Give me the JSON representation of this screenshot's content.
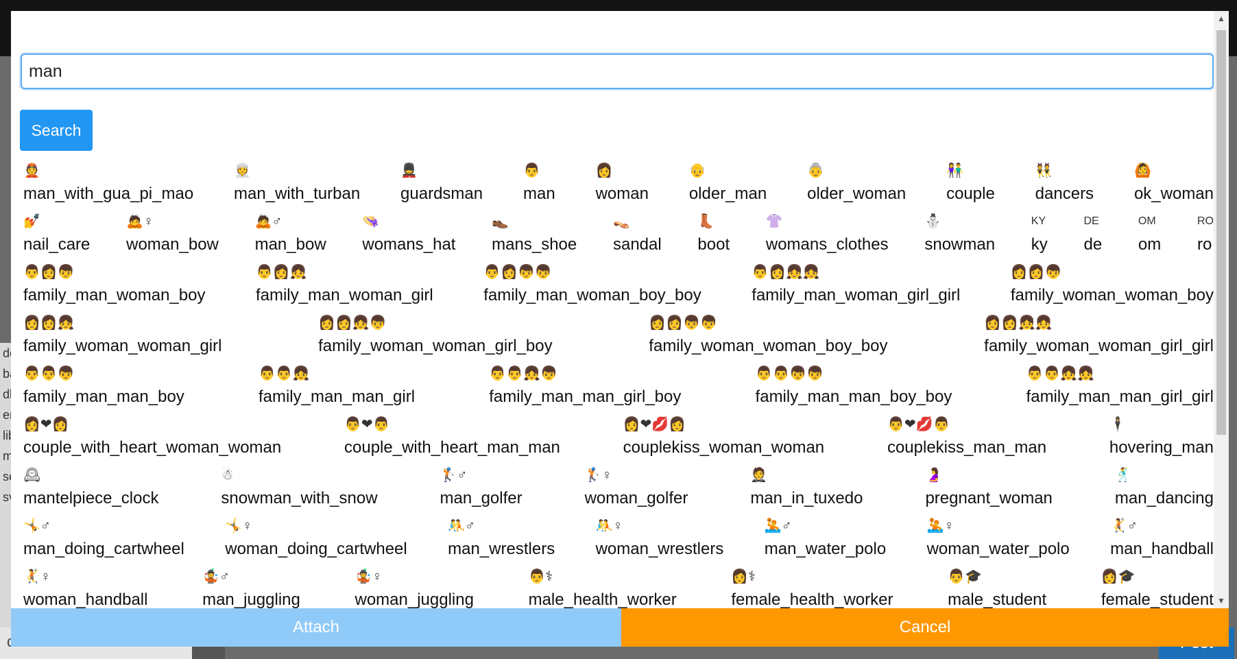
{
  "background": {
    "side_lines": [
      "de",
      "ba",
      "dl",
      "er",
      "lib",
      "m",
      "se",
      "sv"
    ],
    "bottom_field_text": "devnewton",
    "post_label": "Post"
  },
  "search": {
    "value": "man",
    "button_label": "Search"
  },
  "results": [
    [
      {
        "emoji": "👲",
        "name": "man_with_gua_pi_mao"
      },
      {
        "emoji": "👳",
        "name": "man_with_turban"
      },
      {
        "emoji": "💂",
        "name": "guardsman"
      },
      {
        "emoji": "👨",
        "name": "man"
      },
      {
        "emoji": "👩",
        "name": "woman"
      },
      {
        "emoji": "👴",
        "name": "older_man"
      },
      {
        "emoji": "👵",
        "name": "older_woman"
      },
      {
        "emoji": "👫",
        "name": "couple"
      },
      {
        "emoji": "👯",
        "name": "dancers"
      },
      {
        "emoji": "🙆",
        "name": "ok_woman"
      }
    ],
    [
      {
        "emoji": "💅",
        "name": "nail_care"
      },
      {
        "emoji": "🙇♀",
        "name": "woman_bow"
      },
      {
        "emoji": "🙇♂",
        "name": "man_bow"
      },
      {
        "emoji": "👒",
        "name": "womans_hat"
      },
      {
        "emoji": "👞",
        "name": "mans_shoe"
      },
      {
        "emoji": "👡",
        "name": "sandal"
      },
      {
        "emoji": "👢",
        "name": "boot"
      },
      {
        "emoji": "👚",
        "name": "womans_clothes"
      },
      {
        "emoji": "⛄",
        "name": "snowman"
      },
      {
        "emoji": "KY",
        "name": "ky"
      },
      {
        "emoji": "DE",
        "name": "de"
      },
      {
        "emoji": "OM",
        "name": "om"
      },
      {
        "emoji": "RO",
        "name": "ro"
      }
    ],
    [
      {
        "emoji": "👨👩👦",
        "name": "family_man_woman_boy"
      },
      {
        "emoji": "👨👩👧",
        "name": "family_man_woman_girl"
      },
      {
        "emoji": "👨👩👦👦",
        "name": "family_man_woman_boy_boy"
      },
      {
        "emoji": "👨👩👧👧",
        "name": "family_man_woman_girl_girl"
      },
      {
        "emoji": "👩👩👦",
        "name": "family_woman_woman_boy"
      }
    ],
    [
      {
        "emoji": "👩👩👧",
        "name": "family_woman_woman_girl"
      },
      {
        "emoji": "👩👩👧👦",
        "name": "family_woman_woman_girl_boy"
      },
      {
        "emoji": "👩👩👦👦",
        "name": "family_woman_woman_boy_boy"
      },
      {
        "emoji": "👩👩👧👧",
        "name": "family_woman_woman_girl_girl"
      }
    ],
    [
      {
        "emoji": "👨👨👦",
        "name": "family_man_man_boy"
      },
      {
        "emoji": "👨👨👧",
        "name": "family_man_man_girl"
      },
      {
        "emoji": "👨👨👧👦",
        "name": "family_man_man_girl_boy"
      },
      {
        "emoji": "👨👨👦👦",
        "name": "family_man_man_boy_boy"
      },
      {
        "emoji": "👨👨👧👧",
        "name": "family_man_man_girl_girl"
      }
    ],
    [
      {
        "emoji": "👩❤👩",
        "name": "couple_with_heart_woman_woman"
      },
      {
        "emoji": "👨❤👨",
        "name": "couple_with_heart_man_man"
      },
      {
        "emoji": "👩❤💋👩",
        "name": "couplekiss_woman_woman"
      },
      {
        "emoji": "👨❤💋👨",
        "name": "couplekiss_man_man"
      },
      {
        "emoji": "🕴",
        "name": "hovering_man"
      }
    ],
    [
      {
        "emoji": "🕰",
        "name": "mantelpiece_clock"
      },
      {
        "emoji": "☃",
        "name": "snowman_with_snow"
      },
      {
        "emoji": "🏌♂",
        "name": "man_golfer"
      },
      {
        "emoji": "🏌♀",
        "name": "woman_golfer"
      },
      {
        "emoji": "🤵",
        "name": "man_in_tuxedo"
      },
      {
        "emoji": "🤰",
        "name": "pregnant_woman"
      },
      {
        "emoji": "🕺",
        "name": "man_dancing"
      }
    ],
    [
      {
        "emoji": "🤸♂",
        "name": "man_doing_cartwheel"
      },
      {
        "emoji": "🤸♀",
        "name": "woman_doing_cartwheel"
      },
      {
        "emoji": "🤼♂",
        "name": "man_wrestlers"
      },
      {
        "emoji": "🤼♀",
        "name": "woman_wrestlers"
      },
      {
        "emoji": "🤽♂",
        "name": "man_water_polo"
      },
      {
        "emoji": "🤽♀",
        "name": "woman_water_polo"
      },
      {
        "emoji": "🤾♂",
        "name": "man_handball"
      }
    ],
    [
      {
        "emoji": "🤾♀",
        "name": "woman_handball"
      },
      {
        "emoji": "🤹♂",
        "name": "man_juggling"
      },
      {
        "emoji": "🤹♀",
        "name": "woman_juggling"
      },
      {
        "emoji": "👨⚕",
        "name": "male_health_worker"
      },
      {
        "emoji": "👩⚕",
        "name": "female_health_worker"
      },
      {
        "emoji": "👨🎓",
        "name": "male_student"
      },
      {
        "emoji": "👩🎓",
        "name": "female_student"
      }
    ]
  ],
  "actions": {
    "attach_label": "Attach",
    "cancel_label": "Cancel"
  }
}
